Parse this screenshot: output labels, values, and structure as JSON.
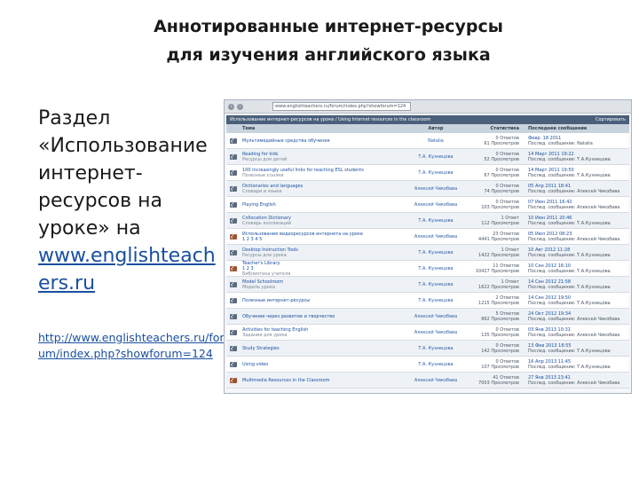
{
  "slide": {
    "title_line1": "Аннотированные интернет-ресурсы",
    "title_line2": "для изучения английского языка",
    "left_text": {
      "line1": "Раздел",
      "line2": "«Использование",
      "line3": "интернет-",
      "line4": "ресурсов на",
      "line5": "уроке» на",
      "link_line1": "www.englishteach",
      "link_line2": "ers.ru"
    },
    "url_text": "http://www.englishteachers.ru/forum/index.php?showforum=124"
  },
  "browser": {
    "back": "‹",
    "forward": "›",
    "address": "www.englishteachers.ru/forum/index.php?showforum=124"
  },
  "forum": {
    "header_title": "Использование интернет-ресурсов на уроке / Using Internet resources in the classroom",
    "header_right": "Сортировать",
    "columns": {
      "topic": "Тема",
      "author": "Автор",
      "stats": "Статистика",
      "last": "Последнее сообщение"
    },
    "topics": [
      {
        "title": "Мультимедийные средства обучения",
        "sub": "",
        "author": "Natalia",
        "stat1": "0 Ответов",
        "stat2": "61 Просмотров",
        "last1": "Февр. 18 2011",
        "last2": "Послед. сообщение: Natalia",
        "hot": false
      },
      {
        "title": "Reading for kids",
        "sub": "Ресурсы для детей",
        "author": "Т.А. Кузнецова",
        "stat1": "0 Ответов",
        "stat2": "52 Просмотров",
        "last1": "14 Март 2011 19:22",
        "last2": "Послед. сообщение: Т.А.Кузнецова",
        "hot": false
      },
      {
        "title": "100 increasingly useful links for teaching ESL students",
        "sub": "Полезные ссылки",
        "author": "Т.А. Кузнецова",
        "stat1": "0 Ответов",
        "stat2": "67 Просмотров",
        "last1": "14 Март 2011 19:50",
        "last2": "Послед. сообщение: Т.А.Кузнецова",
        "hot": false
      },
      {
        "title": "Dictionaries and languages",
        "sub": "Словари и языки",
        "author": "Алексей Чикобава",
        "stat1": "0 Ответов",
        "stat2": "74 Просмотров",
        "last1": "05 Апр 2011 18:41",
        "last2": "Послед. сообщение: Алексей Чикобава",
        "hot": false
      },
      {
        "title": "Playing English",
        "sub": "",
        "author": "Алексей Чикобава",
        "stat1": "0 Ответов",
        "stat2": "103 Просмотров",
        "last1": "07 Июн 2011 16:42",
        "last2": "Послед. сообщение: Алексей Чикобава",
        "hot": false
      },
      {
        "title": "Collocation Dictionary",
        "sub": "Словарь коллокаций",
        "author": "Т.А. Кузнецова",
        "stat1": "1 Ответ",
        "stat2": "112 Просмотров",
        "last1": "10 Июн 2011 20:46",
        "last2": "Послед. сообщение: Т.А.Кузнецова",
        "hot": false
      },
      {
        "title": "Использование видеоресурсов интернета на уроке",
        "sub": "",
        "author": "Алексей Чикобава",
        "pages": "1 2 3 4 5",
        "stat1": "23 Ответов",
        "stat2": "4441 Просмотров",
        "last1": "05 Июл 2012 08:23",
        "last2": "Послед. сообщение: Алексей Чикобава",
        "hot": true
      },
      {
        "title": "Desktop Instruction Tools",
        "sub": "Ресурсы для урока",
        "author": "Т.А. Кузнецова",
        "stat1": "1 Ответ",
        "stat2": "1422 Просмотров",
        "last1": "10 Авг 2012 11:28",
        "last2": "Послед. сообщение: Т.А.Кузнецова",
        "hot": false
      },
      {
        "title": "Teacher's Library",
        "sub": "Библиотека учителя",
        "pages": "1 2 3",
        "author": "Т.А. Кузнецова",
        "stat1": "11 Ответов",
        "stat2": "10427 Просмотров",
        "last1": "10 Сен 2012 16:10",
        "last2": "Послед. сообщение: Т.А.Кузнецова",
        "hot": true
      },
      {
        "title": "Model Schoolroom",
        "sub": "Модель урока",
        "author": "Т.А. Кузнецова",
        "stat1": "1 Ответ",
        "stat2": "1622 Просмотров",
        "last1": "14 Сен 2012 21:58",
        "last2": "Послед. сообщение: Т.А.Кузнецова",
        "hot": false
      },
      {
        "title": "Полезные интернет-ресурсы",
        "sub": "",
        "author": "Т.А. Кузнецова",
        "stat1": "2 Ответов",
        "stat2": "1215 Просмотров",
        "last1": "14 Сен 2012 19:50",
        "last2": "Послед. сообщение: Т.А.Кузнецова",
        "hot": false
      },
      {
        "title": "Обучение через развитие и творчество",
        "sub": "",
        "author": "Алексей Чикобава",
        "stat1": "5 Ответов",
        "stat2": "862 Просмотров",
        "last1": "24 Окт 2012 19:34",
        "last2": "Послед. сообщение: Алексей Чикобава",
        "hot": false
      },
      {
        "title": "Activities for teaching English",
        "sub": "Задания для урока",
        "author": "Алексей Чикобава",
        "stat1": "0 Ответов",
        "stat2": "135 Просмотров",
        "last1": "03 Янв 2013 10:31",
        "last2": "Послед. сообщение: Алексей Чикобава",
        "hot": false
      },
      {
        "title": "Study Strategies",
        "sub": "",
        "author": "Т.А. Кузнецова",
        "stat1": "0 Ответов",
        "stat2": "142 Просмотров",
        "last1": "13 Фев 2013 18:55",
        "last2": "Послед. сообщение: Т.А.Кузнецова",
        "hot": false
      },
      {
        "title": "Using video",
        "sub": "",
        "author": "Т.А. Кузнецова",
        "stat1": "0 Ответов",
        "stat2": "107 Просмотров",
        "last1": "16 Апр 2013 11:45",
        "last2": "Послед. сообщение: Т.А.Кузнецова",
        "hot": false
      },
      {
        "title": "Multimedia Resources in the Classroom",
        "sub": "",
        "author": "Алексей Чикобава",
        "stat1": "41 Ответов",
        "stat2": "7003 Просмотров",
        "last1": "27 Янв 2013 23:41",
        "last2": "Послед. сообщение: Алексей Чикобава",
        "hot": true
      }
    ]
  }
}
